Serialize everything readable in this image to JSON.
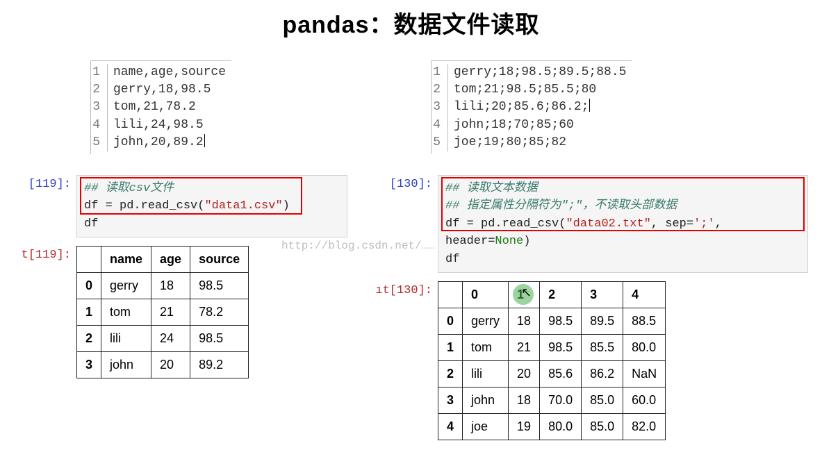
{
  "title": "pandas：数据文件读取",
  "watermark": "http://blog.csdn.net/……",
  "left": {
    "file_lines": [
      "name,age,source",
      "gerry,18,98.5",
      "tom,21,78.2",
      "lili,24,98.5",
      "john,20,89.2"
    ],
    "prompt_in": "[119]:",
    "prompt_out": "t[119]:",
    "code_comment": "## 读取csv文件",
    "code_call_pre": "df = pd.read_csv(",
    "code_call_str": "\"data1.csv\"",
    "code_call_post": ")",
    "code_line3": "df",
    "df_headers": [
      "name",
      "age",
      "source"
    ],
    "df_rows": [
      [
        "0",
        "gerry",
        "18",
        "98.5"
      ],
      [
        "1",
        "tom",
        "21",
        "78.2"
      ],
      [
        "2",
        "lili",
        "24",
        "98.5"
      ],
      [
        "3",
        "john",
        "20",
        "89.2"
      ]
    ]
  },
  "right": {
    "file_lines": [
      "gerry;18;98.5;89.5;88.5",
      "tom;21;98.5;85.5;80",
      "lili;20;85.6;86.2;",
      "john;18;70;85;60",
      "joe;19;80;85;82"
    ],
    "prompt_in": "[130]:",
    "prompt_out": "ıt[130]:",
    "code_comment1": "## 读取文本数据",
    "code_comment2": "## 指定属性分隔符为\";\"，不读取头部数据",
    "code_call_pre": "df = pd.read_csv(",
    "code_call_str1": "\"data02.txt\"",
    "code_call_mid": ", sep=",
    "code_call_str2": "';'",
    "code_call_mid2": ", header=",
    "code_call_kw": "None",
    "code_call_post": ")",
    "code_line4": "df",
    "df_headers": [
      "0",
      "1",
      "2",
      "3",
      "4"
    ],
    "df_rows": [
      [
        "0",
        "gerry",
        "18",
        "98.5",
        "89.5",
        "88.5"
      ],
      [
        "1",
        "tom",
        "21",
        "98.5",
        "85.5",
        "80.0"
      ],
      [
        "2",
        "lili",
        "20",
        "85.6",
        "86.2",
        "NaN"
      ],
      [
        "3",
        "john",
        "18",
        "70.0",
        "85.0",
        "60.0"
      ],
      [
        "4",
        "joe",
        "19",
        "80.0",
        "85.0",
        "82.0"
      ]
    ]
  }
}
